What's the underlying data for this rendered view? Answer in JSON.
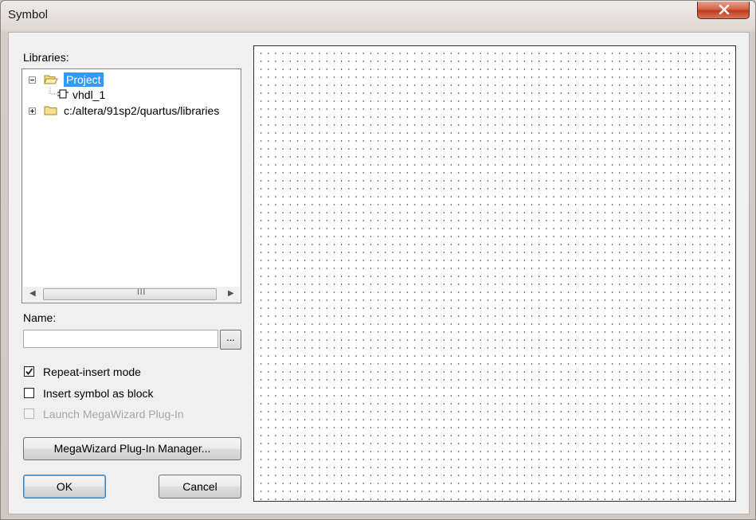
{
  "window": {
    "title": "Symbol"
  },
  "libraries": {
    "label": "Libraries:",
    "items": [
      {
        "label": "Project",
        "expanded": true,
        "selected": true
      },
      {
        "label": "vhdl_1"
      },
      {
        "label": "c:/altera/91sp2/quartus/libraries",
        "expanded": false
      }
    ],
    "scroll_grip": "III"
  },
  "name": {
    "label": "Name:",
    "value": "",
    "browse_label": "..."
  },
  "options": {
    "repeat_insert": {
      "label": "Repeat-insert mode",
      "checked": true
    },
    "insert_as_block": {
      "label": "Insert symbol as block",
      "checked": false
    },
    "launch_megawizard": {
      "label": "Launch MegaWizard Plug-In",
      "checked": false,
      "disabled": true
    }
  },
  "buttons": {
    "megawizard_manager": "MegaWizard Plug-In Manager...",
    "ok": "OK",
    "cancel": "Cancel"
  },
  "colors": {
    "selection": "#3399ff",
    "close_button": "#c0391f"
  }
}
